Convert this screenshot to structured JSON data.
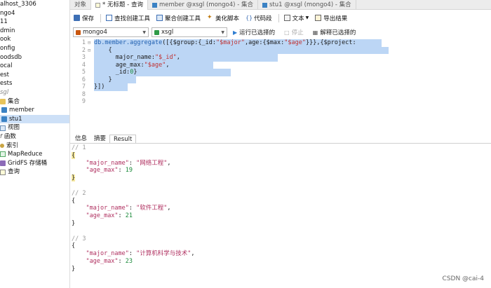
{
  "sidebar": {
    "items": [
      {
        "label": "alhost_3306",
        "icon": "none"
      },
      {
        "label": "ngo4",
        "icon": "none"
      },
      {
        "label": "11",
        "icon": "none"
      },
      {
        "label": "dmin",
        "icon": "none"
      },
      {
        "label": "ook",
        "icon": "none"
      },
      {
        "label": "onfig",
        "icon": "none"
      },
      {
        "label": "oodsdb",
        "icon": "none"
      },
      {
        "label": "ocal",
        "icon": "none"
      },
      {
        "label": "est",
        "icon": "none"
      },
      {
        "label": "ests",
        "icon": "none"
      },
      {
        "label": "sgl",
        "icon": "none"
      },
      {
        "label": "集合",
        "icon": "folder"
      },
      {
        "label": "member",
        "icon": "table"
      },
      {
        "label": "stu1",
        "icon": "table"
      },
      {
        "label": "视图",
        "icon": "view"
      },
      {
        "label": "函数",
        "icon": "func"
      },
      {
        "label": "索引",
        "icon": "key"
      },
      {
        "label": "MapReduce",
        "icon": "mr"
      },
      {
        "label": "GridFS 存储桶",
        "icon": "grid"
      },
      {
        "label": "查询",
        "icon": "query"
      }
    ]
  },
  "tabs": [
    {
      "label": "对象"
    },
    {
      "label": "* 无标题 - 查询"
    },
    {
      "label": "member @xsgl (mongo4) - 集合"
    },
    {
      "label": "stu1 @xsgl (mongo4) - 集合"
    }
  ],
  "toolbar": {
    "save": "保存",
    "find_builder": "查找创建工具",
    "aggregate_builder": "聚合创建工具",
    "beautify": "美化脚本",
    "snippet": "代码段",
    "text": "文本",
    "export": "导出结果"
  },
  "selectors": {
    "connection": "mongo4",
    "database": "xsgl",
    "run_selected": "运行已选择的",
    "stop": "停止",
    "explain_selected": "解释已选择的"
  },
  "editor": {
    "lines": [
      {
        "n": "1",
        "parts": [
          {
            "t": "db.member.aggregate",
            "c": "fn"
          },
          {
            "t": "([{$group:{_id:",
            "c": "pl"
          },
          {
            "t": "\"$major\"",
            "c": "str"
          },
          {
            "t": ",age:{$max:",
            "c": "pl"
          },
          {
            "t": "\"$age\"",
            "c": "str"
          },
          {
            "t": "}}},{$project:",
            "c": "pl"
          }
        ]
      },
      {
        "n": "2",
        "parts": [
          {
            "t": "    {",
            "c": "pl"
          }
        ]
      },
      {
        "n": "3",
        "parts": [
          {
            "t": "      major_name:",
            "c": "pl"
          },
          {
            "t": "\"$_id\"",
            "c": "str"
          },
          {
            "t": ",",
            "c": "pl"
          }
        ]
      },
      {
        "n": "4",
        "parts": [
          {
            "t": "      age_max:",
            "c": "pl"
          },
          {
            "t": "\"$age\"",
            "c": "str"
          },
          {
            "t": ",",
            "c": "pl"
          }
        ]
      },
      {
        "n": "5",
        "parts": [
          {
            "t": "      _id:",
            "c": "pl"
          },
          {
            "t": "0",
            "c": "num"
          },
          {
            "t": "}",
            "c": "pl"
          }
        ]
      },
      {
        "n": "6",
        "parts": [
          {
            "t": "    }",
            "c": "pl"
          }
        ]
      },
      {
        "n": "7",
        "parts": [
          {
            "t": "}])",
            "c": "pl"
          }
        ]
      },
      {
        "n": "8",
        "parts": []
      },
      {
        "n": "9",
        "parts": []
      }
    ]
  },
  "result_tabs": [
    {
      "label": "信息"
    },
    {
      "label": "摘要"
    },
    {
      "label": "Result"
    }
  ],
  "results": [
    {
      "index": "// 1",
      "major_name": "\"网络工程\"",
      "age_max": "19"
    },
    {
      "index": "// 2",
      "major_name": "\"软件工程\"",
      "age_max": "21"
    },
    {
      "index": "// 3",
      "major_name": "\"计算机科学与技术\"",
      "age_max": "23"
    }
  ],
  "watermark": "CSDN @cai-4"
}
